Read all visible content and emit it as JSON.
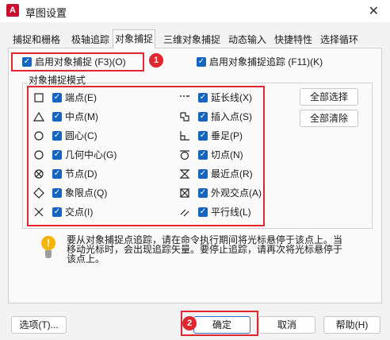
{
  "window": {
    "title": "草图设置",
    "app_icon_letter": "A",
    "close_glyph": "✕"
  },
  "tabs": [
    "捕捉和栅格",
    "极轴追踪",
    "对象捕捉",
    "三维对象捕捉",
    "动态输入",
    "快捷特性",
    "选择循环"
  ],
  "active_tab_index": 2,
  "toggles": {
    "osnap_on": {
      "label": "启用对象捕捉 (F3)(O)",
      "checked": true
    },
    "osnap_tracking": {
      "label": "启用对象捕捉追踪 (F11)(K)",
      "checked": true
    }
  },
  "modes_group_title": "对象捕捉模式",
  "modes_left": [
    {
      "symbol": "square-symbol",
      "label": "端点(E)",
      "checked": true
    },
    {
      "symbol": "triangle-symbol",
      "label": "中点(M)",
      "checked": true
    },
    {
      "symbol": "circle-symbol",
      "label": "圆心(C)",
      "checked": true
    },
    {
      "symbol": "circle-symbol",
      "label": "几何中心(G)",
      "checked": true
    },
    {
      "symbol": "node-symbol",
      "label": "节点(D)",
      "checked": true
    },
    {
      "symbol": "diamond-symbol",
      "label": "象限点(Q)",
      "checked": true
    },
    {
      "symbol": "cross-symbol",
      "label": "交点(I)",
      "checked": true
    }
  ],
  "modes_right": [
    {
      "symbol": "extension-symbol",
      "label": "延长线(X)",
      "checked": true
    },
    {
      "symbol": "insertion-symbol",
      "label": "插入点(S)",
      "checked": true
    },
    {
      "symbol": "perpendicular-symbol",
      "label": "垂足(P)",
      "checked": true
    },
    {
      "symbol": "tangent-symbol",
      "label": "切点(N)",
      "checked": true
    },
    {
      "symbol": "nearest-symbol",
      "label": "最近点(R)",
      "checked": true
    },
    {
      "symbol": "apparent-intersection-symbol",
      "label": "外观交点(A)",
      "checked": true
    },
    {
      "symbol": "parallel-symbol",
      "label": "平行线(L)",
      "checked": true
    }
  ],
  "side_buttons": {
    "select_all": "全部选择",
    "clear_all": "全部清除"
  },
  "info": {
    "icon": "!",
    "line1": "要从对象捕捉点追踪，请在命令执行期间将光标悬停于该点上。当",
    "line2": "移动光标时，会出现追踪矢量。要停止追踪，请再次将光标悬停于",
    "line3": "该点上。"
  },
  "footer": {
    "options": "选项(T)...",
    "ok": "确定",
    "cancel": "取消",
    "help": "帮助(H)"
  },
  "annotations": {
    "step1": "1",
    "step2": "2"
  },
  "colors": {
    "accent": "#1565c0",
    "annotation_red": "#e0262f",
    "warning": "#f4b400"
  }
}
